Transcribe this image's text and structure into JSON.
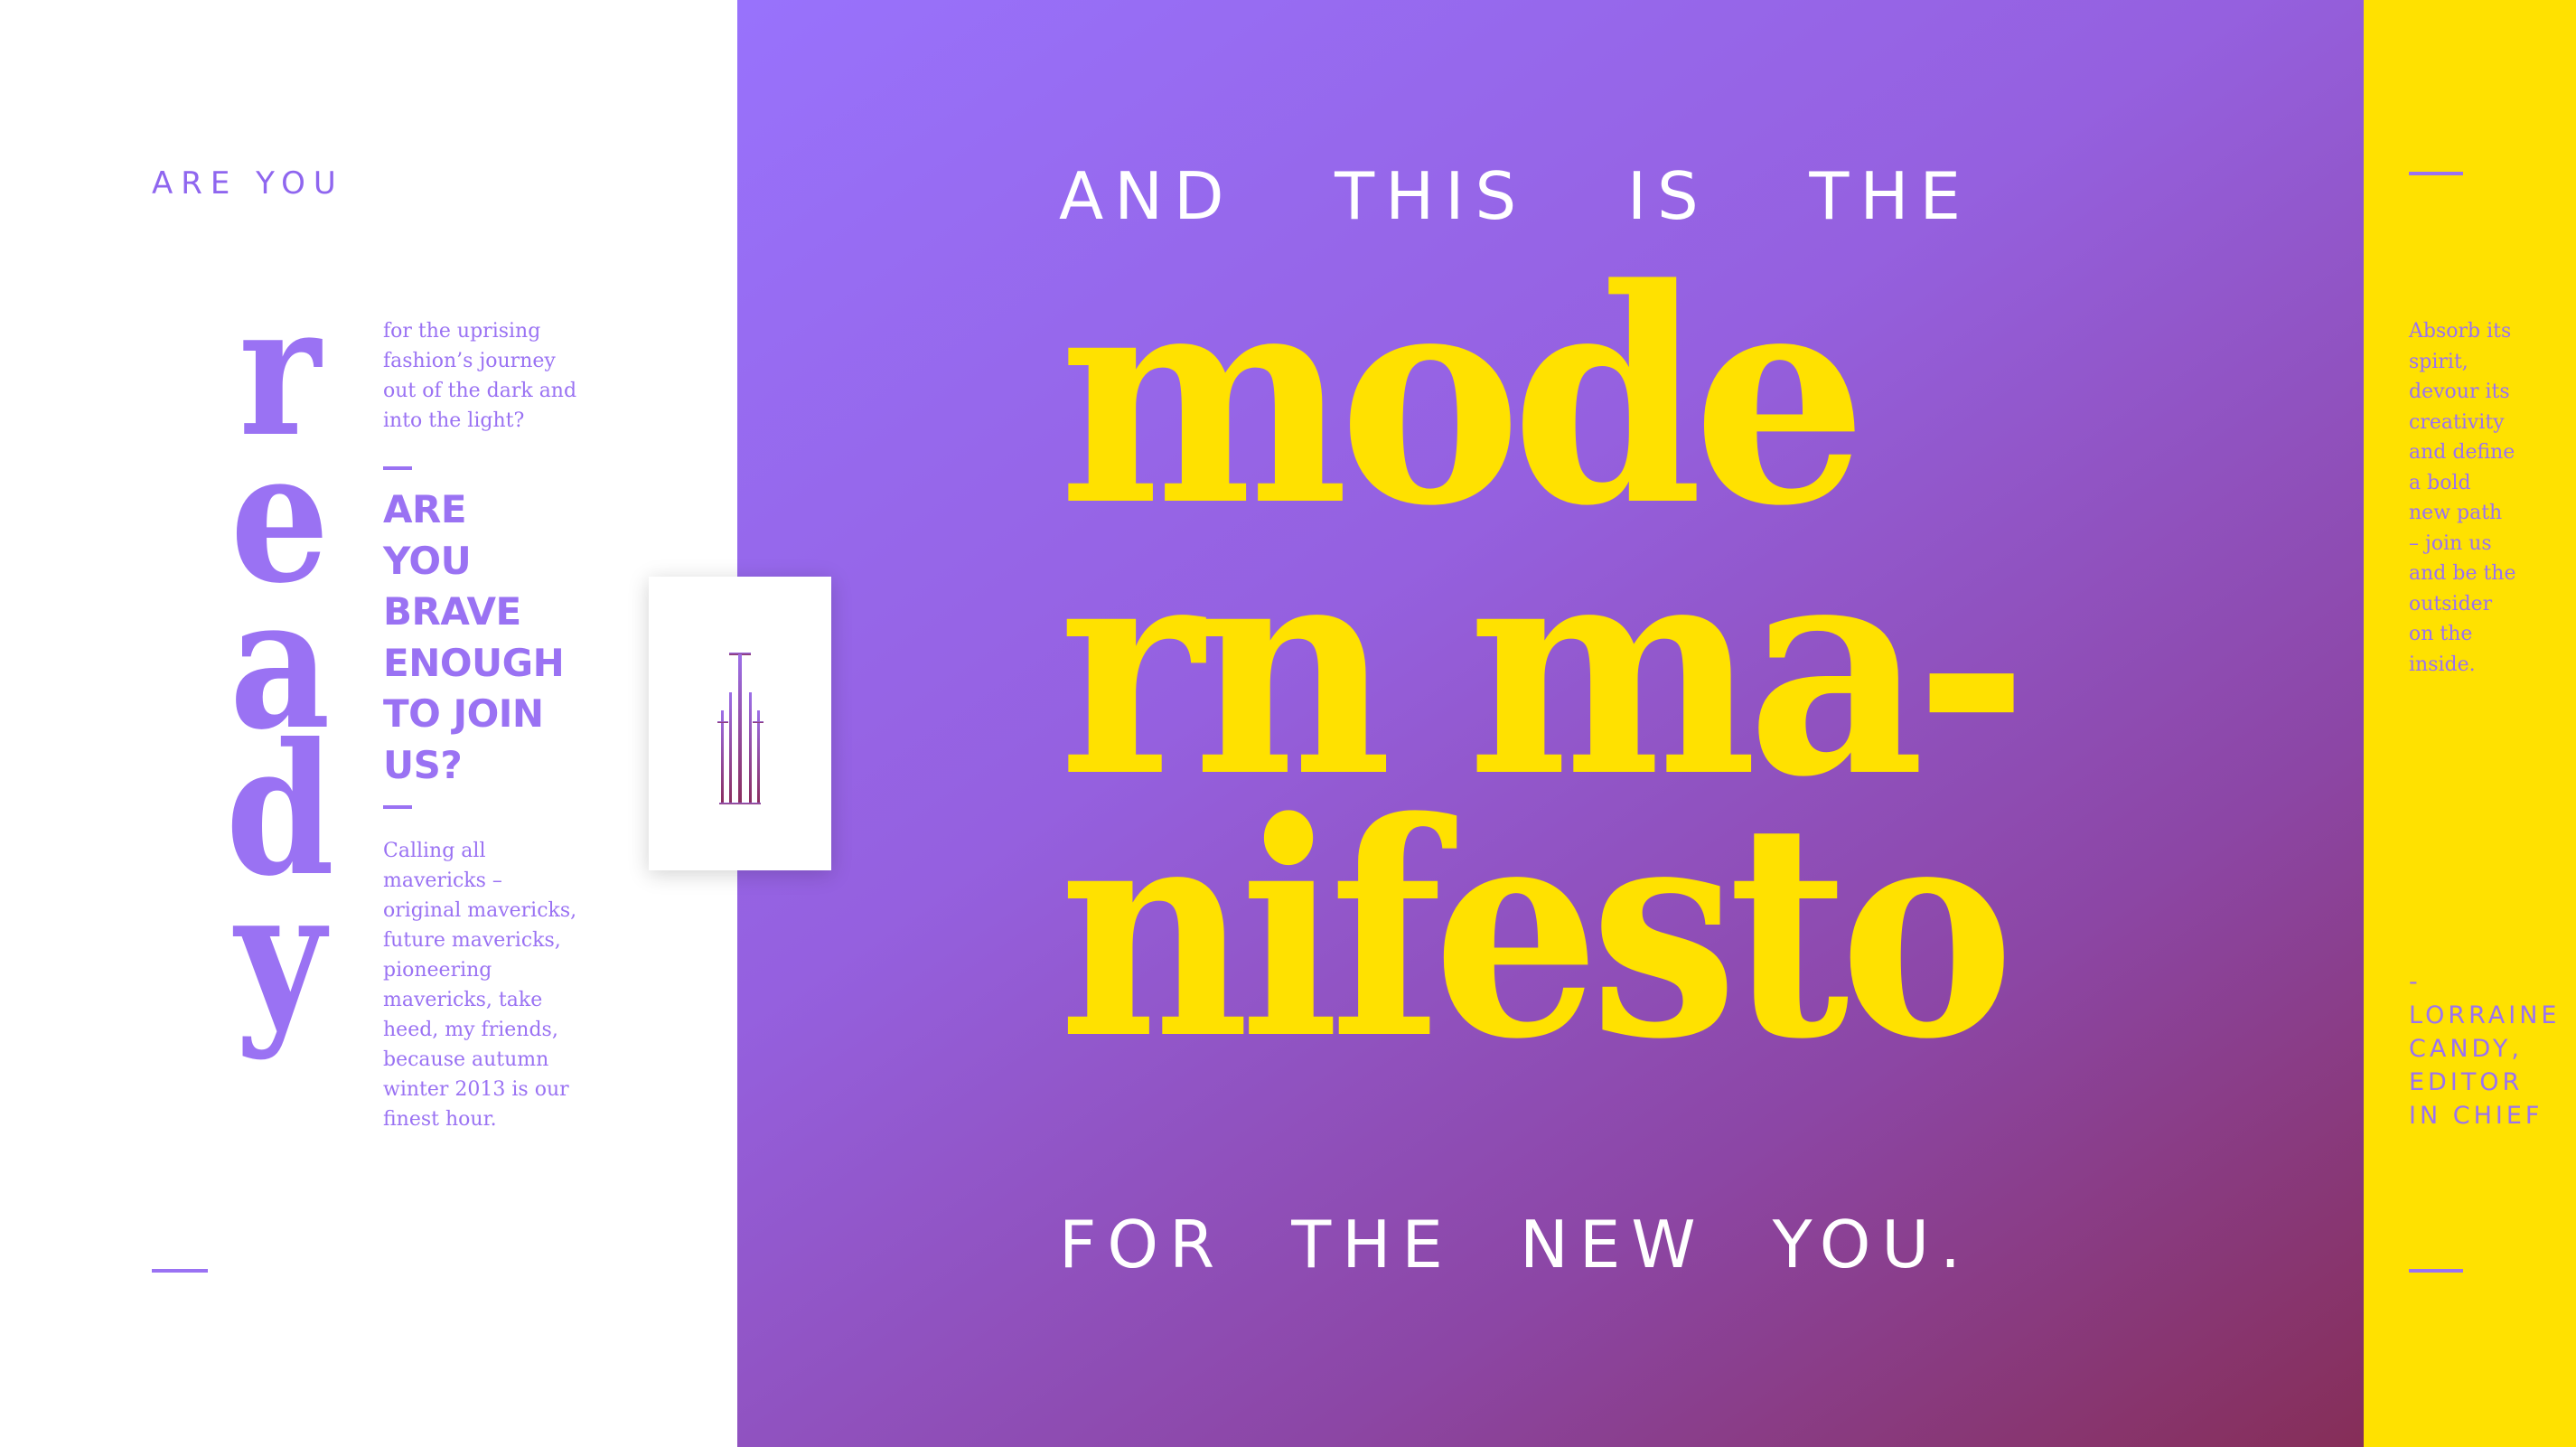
{
  "left": {
    "eyebrow": "ARE YOU",
    "vertical_word": [
      "r",
      "e",
      "a",
      "d",
      "y"
    ],
    "intro": "for the uprising fashion’s journey out of the dark and into the light?",
    "brave_lines": [
      "ARE",
      "YOU",
      "BRAVE",
      "ENOUGH",
      "TO JOIN",
      "US?"
    ],
    "outro": "Calling all mavericks – original mavericks, future mavericks, pioneering mavericks, take heed, my friends, because autumn winter 2013 is our finest hour."
  },
  "center": {
    "top_words": [
      "AND",
      "THIS",
      "IS",
      "THE"
    ],
    "headline_lines": [
      "mode",
      "rn ma-",
      "nifesto"
    ],
    "bottom_words": [
      "FOR",
      "THE",
      "NEW",
      "YOU."
    ]
  },
  "right": {
    "text": "Absorb its spirit, devour its creativity and define a bold new path – join us and be the outsider on the inside.",
    "credit_prefix": "-",
    "credit_lines": [
      "LORRAINE",
      "CANDY,",
      "EDITOR",
      "IN CHIEF"
    ]
  },
  "colors": {
    "purple": "#9a72f3",
    "yellow": "#ffe100",
    "gradient_start": "#9872fc",
    "gradient_end": "#862e58",
    "white": "#ffffff"
  },
  "icons": {
    "logo": "elle-monogram-logo"
  }
}
